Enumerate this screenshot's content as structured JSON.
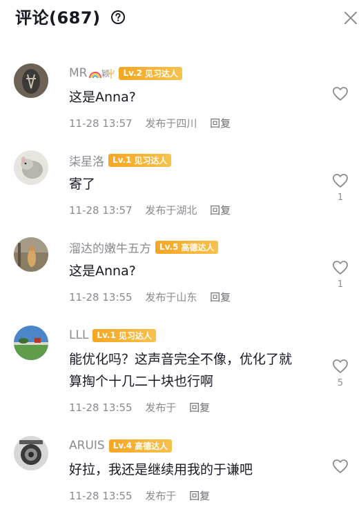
{
  "header": {
    "title": "评论(687)",
    "help_icon": "question-circle-icon",
    "close_icon": "close-icon"
  },
  "comments": [
    {
      "username": "MR",
      "badge_level": "Lv.2",
      "badge_text": "见习达人",
      "text": "这是Anna?",
      "time": "11-28 13:57",
      "location": "发布于四川",
      "reply_label": "回复",
      "likes": ""
    },
    {
      "username": "柒星洛",
      "badge_level": "Lv.1",
      "badge_text": "见习达人",
      "text": "寄了",
      "time": "11-28 13:57",
      "location": "发布于湖北",
      "reply_label": "回复",
      "likes": "1"
    },
    {
      "username": "溜达的嫩牛五方",
      "badge_level": "Lv.5",
      "badge_text": "高德达人",
      "text": "这是Anna?",
      "time": "11-28 13:55",
      "location": "发布于山东",
      "reply_label": "回复",
      "likes": "1"
    },
    {
      "username": "LLL",
      "badge_level": "Lv.1",
      "badge_text": "见习达人",
      "text": "能优化吗？这声音完全不像，优化了就算掏个十几二十块也行啊",
      "time": "11-28 13:55",
      "location": "发布于",
      "reply_label": "回复",
      "likes": "5"
    },
    {
      "username": "ARUIS",
      "badge_level": "Lv.4",
      "badge_text": "高德达人",
      "text": "好拉，我还是继续用我的于谦吧",
      "time": "11-28 13:55",
      "location": "发布于",
      "reply_label": "回复",
      "likes": ""
    }
  ],
  "colors": {
    "badge": "#f5a623",
    "secondary_text": "#8a8b91",
    "primary_text": "#161823"
  }
}
